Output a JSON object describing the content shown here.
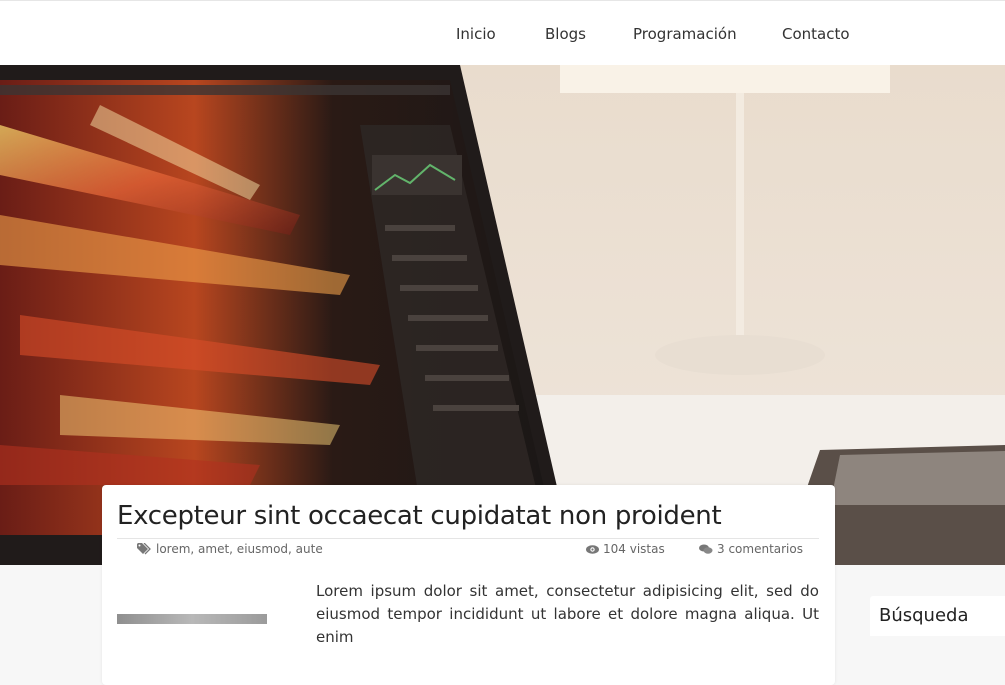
{
  "nav": {
    "items": [
      {
        "label": "Inicio"
      },
      {
        "label": "Blogs"
      },
      {
        "label": "Programación"
      },
      {
        "label": "Contacto"
      }
    ]
  },
  "hero": {
    "image": "laptop-on-desk-photo"
  },
  "post": {
    "title": "Excepteur sint occaecat cupidatat non proident",
    "tags": "lorem, amet, eiusmod, aute",
    "views": "104 vistas",
    "comments": "3 comentarios",
    "excerpt": "Lorem ipsum dolor sit amet, consectetur adipisicing elit, sed do eiusmod tempor incididunt ut labore et dolore magna aliqua. Ut enim",
    "icons": {
      "tags": "tags-icon",
      "views": "eye-icon",
      "comments": "comments-icon"
    }
  },
  "sidebar": {
    "search_title": "Búsqueda"
  },
  "colors": {
    "navbar_bg": "#ffffff",
    "page_bg": "#f7f7f7",
    "text": "#333333",
    "meta_text": "#666666"
  }
}
